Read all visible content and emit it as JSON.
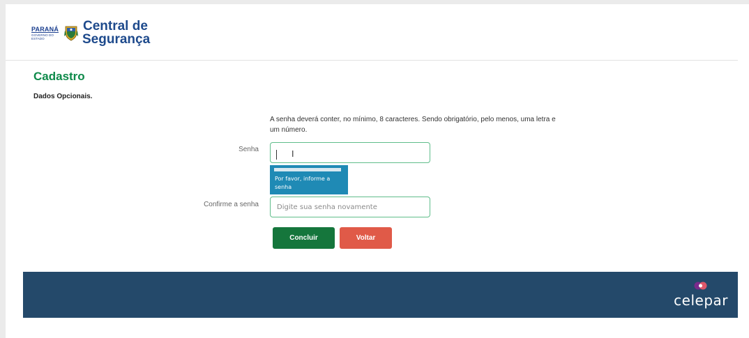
{
  "header": {
    "gov_name": "PARANÁ",
    "gov_subtitle": "GOVERNO DO ESTADO",
    "site_line1": "Central de",
    "site_line2": "Segurança"
  },
  "main": {
    "title": "Cadastro",
    "subtitle": "Dados Opcionais.",
    "help_text": "A senha deverá conter, no mínimo, 8 caracteres. Sendo obrigatório, pelo menos, uma letra e um número.",
    "senha_label": "Senha",
    "senha_value": "",
    "senha_tooltip": "Por favor, informe a senha",
    "confirm_label": "Confirme a senha",
    "confirm_placeholder": "Digite sua senha novamente",
    "confirm_value": "",
    "conclude_button": "Concluir",
    "back_button": "Voltar"
  },
  "footer": {
    "brand": "celepar"
  },
  "colors": {
    "title_green": "#0e8a4a",
    "brand_blue": "#1e4a8c",
    "footer_bg": "#24496a",
    "conclude_bg": "#15763c",
    "back_bg": "#e05a48",
    "tooltip_bg": "#1f8ab5",
    "input_border": "#5fbd8a"
  },
  "icons": [
    "parana-coat-of-arms-icon",
    "celepar-logo-icon",
    "text-cursor-icon"
  ]
}
